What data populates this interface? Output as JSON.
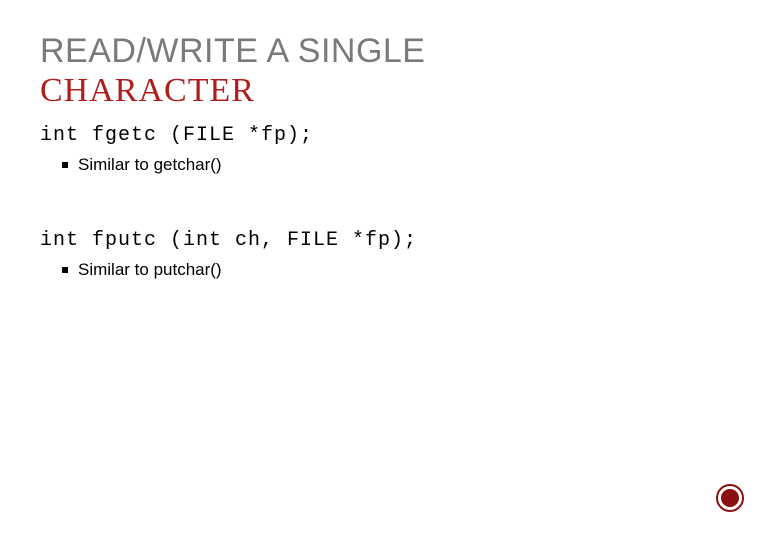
{
  "title": {
    "line1": "READ/WRITE A SINGLE",
    "line2": "CHARACTER"
  },
  "sections": [
    {
      "code": "int fgetc (FILE *fp);",
      "bullets": [
        "Similar to getchar()"
      ]
    },
    {
      "code": "int fputc (int ch, FILE *fp);",
      "bullets": [
        "Similar to putchar()"
      ]
    }
  ]
}
